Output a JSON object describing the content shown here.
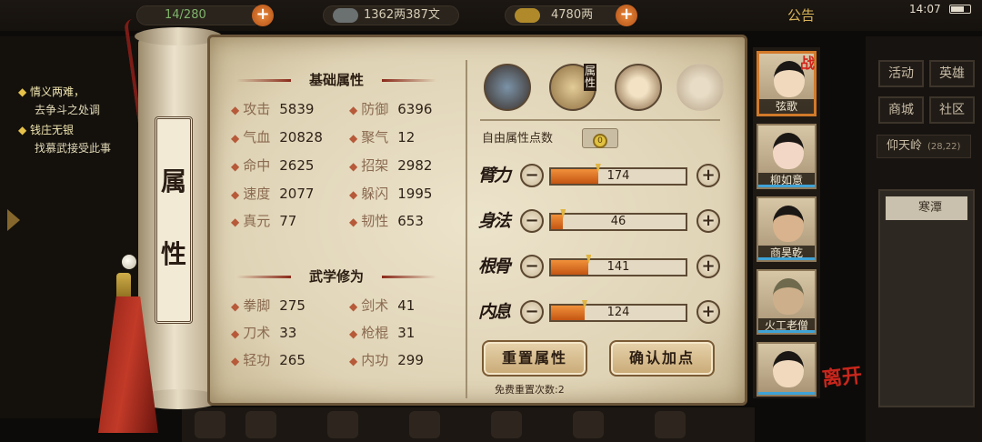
{
  "topbar": {
    "stamina": "14/280",
    "silver": "1362两387文",
    "gold": "4780两",
    "announcement": "公告",
    "clock": "14:07"
  },
  "quests": [
    {
      "title": "情义两难，",
      "desc": "去争斗之处调"
    },
    {
      "title": "钱庄无银",
      "desc": "找慕武接受此事"
    }
  ],
  "right_menu": {
    "buttons": [
      "活动",
      "英雄",
      "商城",
      "社区"
    ],
    "location": "仰天岭",
    "coords": "(28,22)",
    "zone_item": "寒潭"
  },
  "scroll": {
    "title_chars": [
      "属",
      "性"
    ]
  },
  "basic_attrs": {
    "heading": "基础属性",
    "rows": [
      [
        {
          "label": "攻击",
          "value": "5839"
        },
        {
          "label": "防御",
          "value": "6396"
        }
      ],
      [
        {
          "label": "气血",
          "value": "20828"
        },
        {
          "label": "聚气",
          "value": "12"
        }
      ],
      [
        {
          "label": "命中",
          "value": "2625"
        },
        {
          "label": "招架",
          "value": "2982"
        }
      ],
      [
        {
          "label": "速度",
          "value": "2077"
        },
        {
          "label": "躲闪",
          "value": "1995"
        }
      ],
      [
        {
          "label": "真元",
          "value": "77"
        },
        {
          "label": "韧性",
          "value": "653"
        }
      ]
    ]
  },
  "martial": {
    "heading": "武学修为",
    "rows": [
      [
        {
          "label": "拳脚",
          "value": "275"
        },
        {
          "label": "剑术",
          "value": "41"
        }
      ],
      [
        {
          "label": "刀术",
          "value": "33"
        },
        {
          "label": "枪棍",
          "value": "31"
        }
      ],
      [
        {
          "label": "轻功",
          "value": "265"
        },
        {
          "label": "内功",
          "value": "299"
        }
      ]
    ]
  },
  "tabs": {
    "attr_tab_label": "属性"
  },
  "allocation": {
    "free_label": "自由属性点数",
    "free_points": "0",
    "attributes": [
      {
        "name": "臂力",
        "value": "174",
        "fill": 0.35
      },
      {
        "name": "身法",
        "value": "46",
        "fill": 0.09
      },
      {
        "name": "根骨",
        "value": "141",
        "fill": 0.28
      },
      {
        "name": "内息",
        "value": "124",
        "fill": 0.25
      }
    ],
    "reset_button": "重置属性",
    "confirm_button": "确认加点",
    "reset_note": "免费重置次数:2"
  },
  "portraits": {
    "war_badge": "战",
    "characters": [
      {
        "name": "弦歌",
        "selected": true
      },
      {
        "name": "柳如意",
        "selected": false
      },
      {
        "name": "商昊乾",
        "selected": false
      },
      {
        "name": "火工老僧",
        "selected": false
      },
      {
        "name": "",
        "selected": false
      }
    ],
    "leave_label": "离开"
  },
  "colors": {
    "bar_fill": "#e07424",
    "accent_red": "#c8261c",
    "parchment": "#e3d8bc"
  }
}
